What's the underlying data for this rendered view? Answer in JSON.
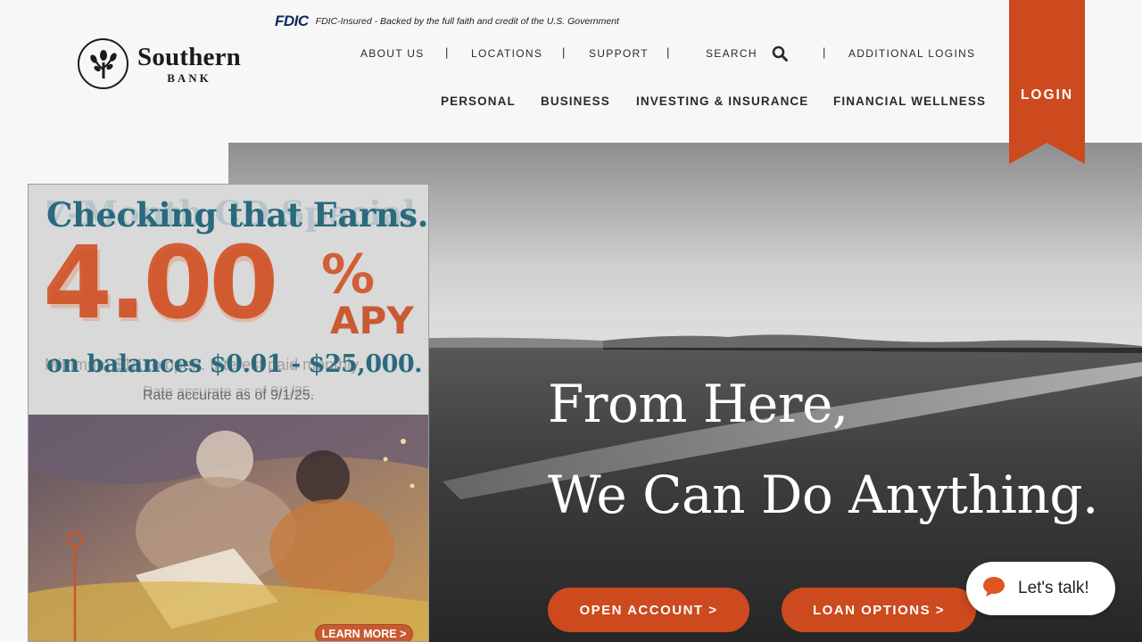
{
  "fdic": {
    "logo_text": "FDIC",
    "tagline": "FDIC-Insured - Backed by the full faith and credit of the U.S. Government"
  },
  "brand": {
    "name": "Southern",
    "sub": "BANK"
  },
  "utility_nav": {
    "about": "ABOUT US",
    "locations": "LOCATIONS",
    "support": "SUPPORT",
    "search": "SEARCH",
    "additional_logins": "ADDITIONAL LOGINS",
    "separator": "|"
  },
  "main_nav": {
    "personal": "PERSONAL",
    "business": "BUSINESS",
    "investing": "INVESTING & INSURANCE",
    "wellness": "FINANCIAL WELLNESS"
  },
  "login": {
    "label": "LOGIN"
  },
  "hero": {
    "line1": "From Here,",
    "line2": "We Can Do Anything.",
    "open_account": "OPEN ACCOUNT >",
    "loan_options": "LOAN OPTIONS >"
  },
  "promo": {
    "ghost_heading": "7-Month CD Special",
    "heading": "Checking that Earns.",
    "rate": "4.00",
    "ghost_rate": "4.00",
    "percent": "%",
    "apy": "APY",
    "balances": "on balances $0.01 - $25,000.",
    "ghost_minimum": "Minimum $1K to open. Interest paid monthly.",
    "ghost_note": "Rate accurate as of 9/1/25.",
    "note": "Rate accurate as of 9/1/25.",
    "learn_more": "LEARN MORE >"
  },
  "chat": {
    "label": "Let's talk!"
  },
  "colors": {
    "accent": "#cc4a1e",
    "teal": "#2a6a7c",
    "navy": "#0d2a5c"
  }
}
